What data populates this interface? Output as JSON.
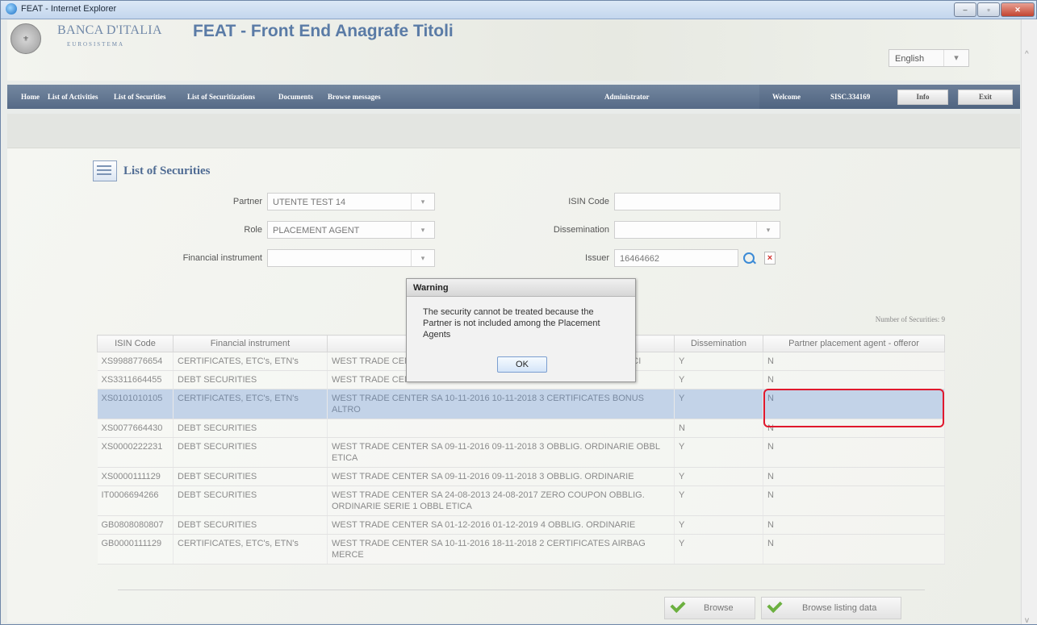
{
  "window": {
    "title": "FEAT - Internet Explorer",
    "controls": [
      "–",
      "▫",
      "✕"
    ]
  },
  "header": {
    "bank": "BANCA D'ITALIA",
    "eurosistema": "EUROSISTEMA",
    "app_title": "FEAT - Front End Anagrafe Titoli",
    "language": "English"
  },
  "nav": {
    "items": [
      "Home",
      "List of Activities",
      "List of Securities",
      "List of Securitizations",
      "Documents",
      "Browse messages",
      "Administrator"
    ],
    "welcome": "Welcome",
    "user": "SISC.334169",
    "info": "Info",
    "exit": "Exit"
  },
  "page": {
    "title": "List of Securities",
    "count_text": "Number of Securities: 9"
  },
  "form": {
    "partner_label": "Partner",
    "partner_value": "UTENTE TEST 14",
    "role_label": "Role",
    "role_value": "PLACEMENT AGENT",
    "fin_label": "Financial instrument",
    "fin_value": "",
    "isin_label": "ISIN Code",
    "isin_value": "",
    "dissemination_label": "Dissemination",
    "dissemination_value": "",
    "issuer_label": "Issuer",
    "issuer_value": "16464662"
  },
  "table": {
    "headers": [
      "ISIN Code",
      "Financial instrument",
      "",
      "Dissemination",
      "Partner placement agent - offeror"
    ],
    "rows": [
      [
        "XS9988776654",
        "CERTIFICATES, ETC's, ETN's",
        "WEST TRADE CENTER SA 01-11-2016 01-11-2018 3 CERTIFICATES MERCI",
        "Y",
        "N"
      ],
      [
        "XS3311664455",
        "DEBT SECURITIES",
        "WEST TRADE CENTER SA 01-11-2016 01-11-2018 3 OBBLIG. ORDINARIE",
        "Y",
        "N"
      ],
      [
        "XS0101010105",
        "CERTIFICATES, ETC's, ETN's",
        "WEST TRADE CENTER SA 10-11-2016 10-11-2018 3 CERTIFICATES BONUS ALTRO",
        "Y",
        "N"
      ],
      [
        "XS0077664430",
        "DEBT SECURITIES",
        "",
        "N",
        "N"
      ],
      [
        "XS0000222231",
        "DEBT SECURITIES",
        "WEST TRADE CENTER SA 09-11-2016 09-11-2018 3 OBBLIG. ORDINARIE OBBL ETICA",
        "Y",
        "N"
      ],
      [
        "XS0000111129",
        "DEBT SECURITIES",
        "WEST TRADE CENTER SA 09-11-2016 09-11-2018 3 OBBLIG. ORDINARIE",
        "Y",
        "N"
      ],
      [
        "IT0006694266",
        "DEBT SECURITIES",
        "WEST TRADE CENTER SA 24-08-2013 24-08-2017 ZERO COUPON OBBLIG. ORDINARIE SERIE 1 OBBL ETICA",
        "Y",
        "N"
      ],
      [
        "GB0808080807",
        "DEBT SECURITIES",
        "WEST TRADE CENTER SA 01-12-2016 01-12-2019 4 OBBLIG. ORDINARIE",
        "Y",
        "N"
      ],
      [
        "GB0000111129",
        "CERTIFICATES, ETC's, ETN's",
        "WEST TRADE CENTER SA 10-11-2016 18-11-2018 2 CERTIFICATES AIRBAG MERCE",
        "Y",
        "N"
      ]
    ]
  },
  "dialog": {
    "title": "Warning",
    "message": "The security cannot be treated because the Partner is not included among the Placement Agents",
    "ok": "OK"
  },
  "buttons": {
    "browse": "Browse",
    "browse_listing": "Browse listing data"
  }
}
